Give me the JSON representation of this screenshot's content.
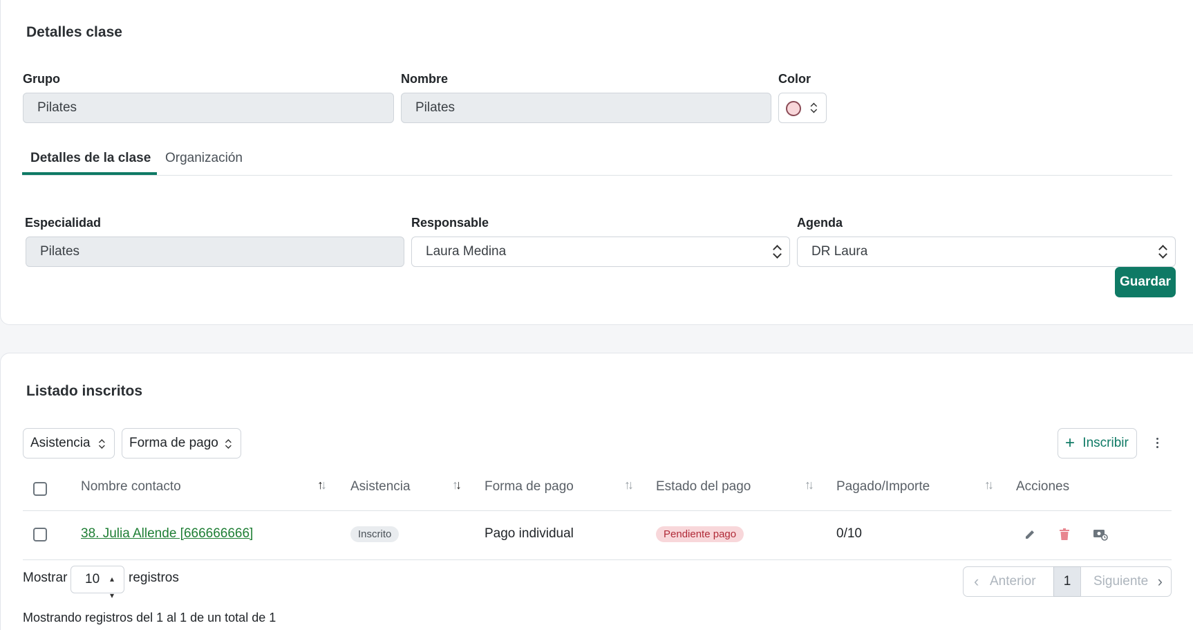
{
  "class_details": {
    "title": "Detalles clase",
    "group_label": "Grupo",
    "group_value": "Pilates",
    "name_label": "Nombre",
    "name_value": "Pilates",
    "color_label": "Color",
    "color_value": "#f8d7da",
    "tabs": [
      "Detalles de la clase",
      "Organización"
    ],
    "specialty_label": "Especialidad",
    "specialty_value": "Pilates",
    "responsible_label": "Responsable",
    "responsible_value": "Laura Medina",
    "agenda_label": "Agenda",
    "agenda_value": "DR Laura",
    "save_label": "Guardar"
  },
  "enrolled": {
    "title": "Listado inscritos",
    "filter_attendance": "Asistencia",
    "filter_payment": "Forma de pago",
    "enroll_label": "Inscribir",
    "columns": [
      "Nombre contacto",
      "Asistencia",
      "Forma de pago",
      "Estado del pago",
      "Pagado/Importe",
      "Acciones"
    ],
    "rows": [
      {
        "contact": "38. Julia Allende [666666666]",
        "attendance": "Inscrito",
        "payment_method": "Pago individual",
        "payment_status": "Pendiente pago",
        "paid_amount": "0/10"
      }
    ],
    "show_label": "Mostrar",
    "page_size": "10",
    "records_label": "registros",
    "prev_label": "Anterior",
    "current_page": "1",
    "next_label": "Siguiente",
    "summary": "Mostrando registros del 1 al 1 de un total de 1"
  },
  "colors": {
    "primary": "#0f7a65",
    "link": "#1e7e34",
    "badge_pending_bg": "#f8d7da",
    "badge_pending_text": "#b02a37"
  }
}
